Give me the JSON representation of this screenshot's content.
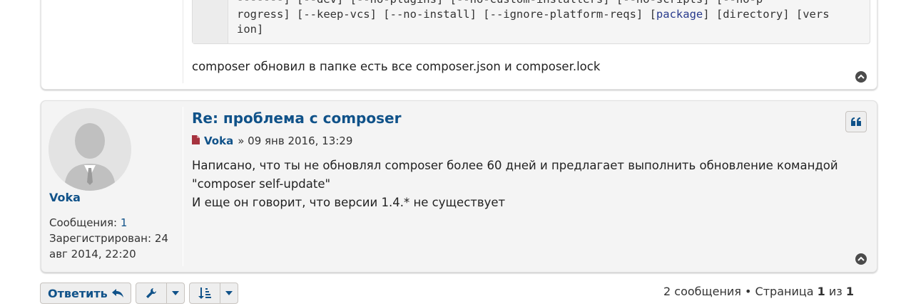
{
  "post1": {
    "code_lines": [
      {
        "segments": [
          {
            "t": "rogress] [--keep-vcs] [--no-install] [--ignore-platform-reqs] [",
            "c": false
          },
          {
            "t": "package",
            "c": true
          },
          {
            "t": "] [directory] [vers",
            "c": false
          }
        ]
      },
      {
        "segments": [
          {
            "t": "ion]",
            "c": false
          }
        ]
      }
    ],
    "body": "composer обновил в папке есть все composer.json и composer.lock"
  },
  "post2": {
    "author": "Voka",
    "profile": {
      "posts_label": "Сообщения:",
      "posts_count": "1",
      "registered_label": "Зарегистрирован:",
      "registered_value": "24 авг 2014, 22:20"
    },
    "title": "Re: проблема с composer",
    "meta_author": "Voka",
    "meta_date": "» 09 янв 2016, 13:29",
    "body_lines": [
      "Написано, что ты не обновлял composer более 60 дней и предлагает выполнить обновление командой",
      "\"composer self-update\"",
      "И еще он говорит, что версии 1.4.* не существует"
    ]
  },
  "actions": {
    "reply_label": "Ответить"
  },
  "pagination": {
    "count_text": "2 сообщения • Страница ",
    "page": "1",
    "of": " из ",
    "total": "1"
  },
  "colors": {
    "link": "#105289",
    "post_alt_bg": "#f4f4f4",
    "button_bg": "#eeeeee"
  }
}
